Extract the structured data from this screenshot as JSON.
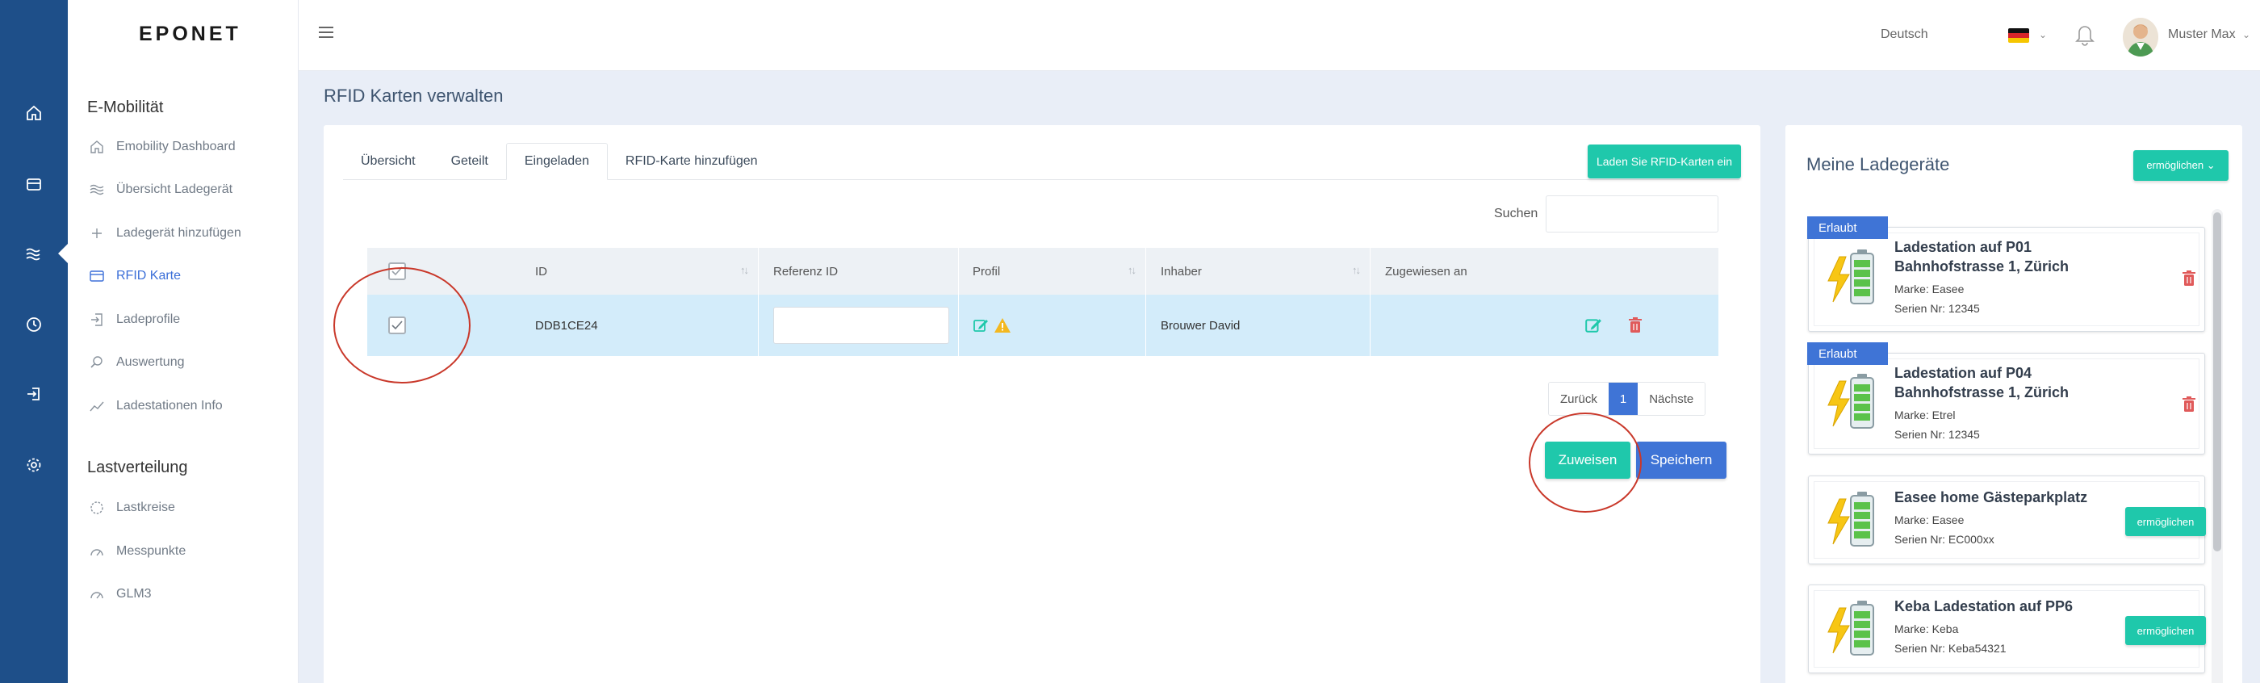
{
  "brand": "EPONET",
  "sidebar": {
    "sections": [
      {
        "title": "E-Mobilität",
        "items": [
          {
            "label": "Emobility Dashboard",
            "icon": "home-icon"
          },
          {
            "label": "Übersicht Ladegerät",
            "icon": "waves-icon"
          },
          {
            "label": "Ladegerät hinzufügen",
            "icon": "plus-icon"
          },
          {
            "label": "RFID Karte",
            "icon": "card-icon",
            "active": true
          },
          {
            "label": "Ladeprofile",
            "icon": "login-icon"
          },
          {
            "label": "Auswertung",
            "icon": "search-icon"
          },
          {
            "label": "Ladestationen Info",
            "icon": "chart-line-icon"
          }
        ]
      },
      {
        "title": "Lastverteilung",
        "items": [
          {
            "label": "Lastkreise",
            "icon": "circle-dashed-icon"
          },
          {
            "label": "Messpunkte",
            "icon": "gauge-icon"
          },
          {
            "label": "GLM3",
            "icon": "gauge-icon"
          }
        ]
      }
    ]
  },
  "header": {
    "language": "Deutsch",
    "user": "Muster Max"
  },
  "page": {
    "title": "RFID Karten verwalten"
  },
  "tabs": [
    {
      "label": "Übersicht",
      "active": false
    },
    {
      "label": "Geteilt",
      "active": false
    },
    {
      "label": "Eingeladen",
      "active": true
    },
    {
      "label": "RFID-Karte hinzufügen",
      "active": false
    }
  ],
  "load_button": "Laden Sie RFID-Karten ein",
  "search": {
    "label": "Suchen",
    "value": ""
  },
  "table": {
    "columns": [
      "ID",
      "Referenz ID",
      "Profil",
      "Inhaber",
      "Zugewiesen an"
    ],
    "rows": [
      {
        "id": "DDB1CE24",
        "referenz": "",
        "inhaber": "Brouwer David",
        "zugewiesen": "",
        "checked": true
      }
    ]
  },
  "pagination": {
    "prev": "Zurück",
    "current": "1",
    "next": "Nächste"
  },
  "actions": {
    "assign": "Zuweisen",
    "save": "Speichern"
  },
  "right_panel": {
    "title": "Meine Ladegeräte",
    "enable_button": "ermöglichen",
    "devices": [
      {
        "badge": "Erlaubt",
        "name": "Ladestation auf P01 Bahnhofstrasse 1, Zürich",
        "brand": "Marke: Easee",
        "serial": "Serien Nr: 12345",
        "action": "delete"
      },
      {
        "badge": "Erlaubt",
        "name": "Ladestation auf P04 Bahnhofstrasse 1, Zürich",
        "brand": "Marke: Etrel",
        "serial": "Serien Nr: 12345",
        "action": "delete"
      },
      {
        "badge": "",
        "name": "Easee home Gästeparkplatz",
        "brand": "Marke: Easee",
        "serial": "Serien Nr: EC000xx",
        "action": "ermöglichen"
      },
      {
        "badge": "",
        "name": "Keba Ladestation auf PP6",
        "brand": "Marke: Keba",
        "serial": "Serien Nr: Keba54321",
        "action": "ermöglichen"
      }
    ]
  },
  "colors": {
    "primary": "#1e4f89",
    "teal": "#1fc8ab",
    "blue": "#3f74d6",
    "danger": "#e05a5a",
    "highlight": "#c9382a"
  }
}
